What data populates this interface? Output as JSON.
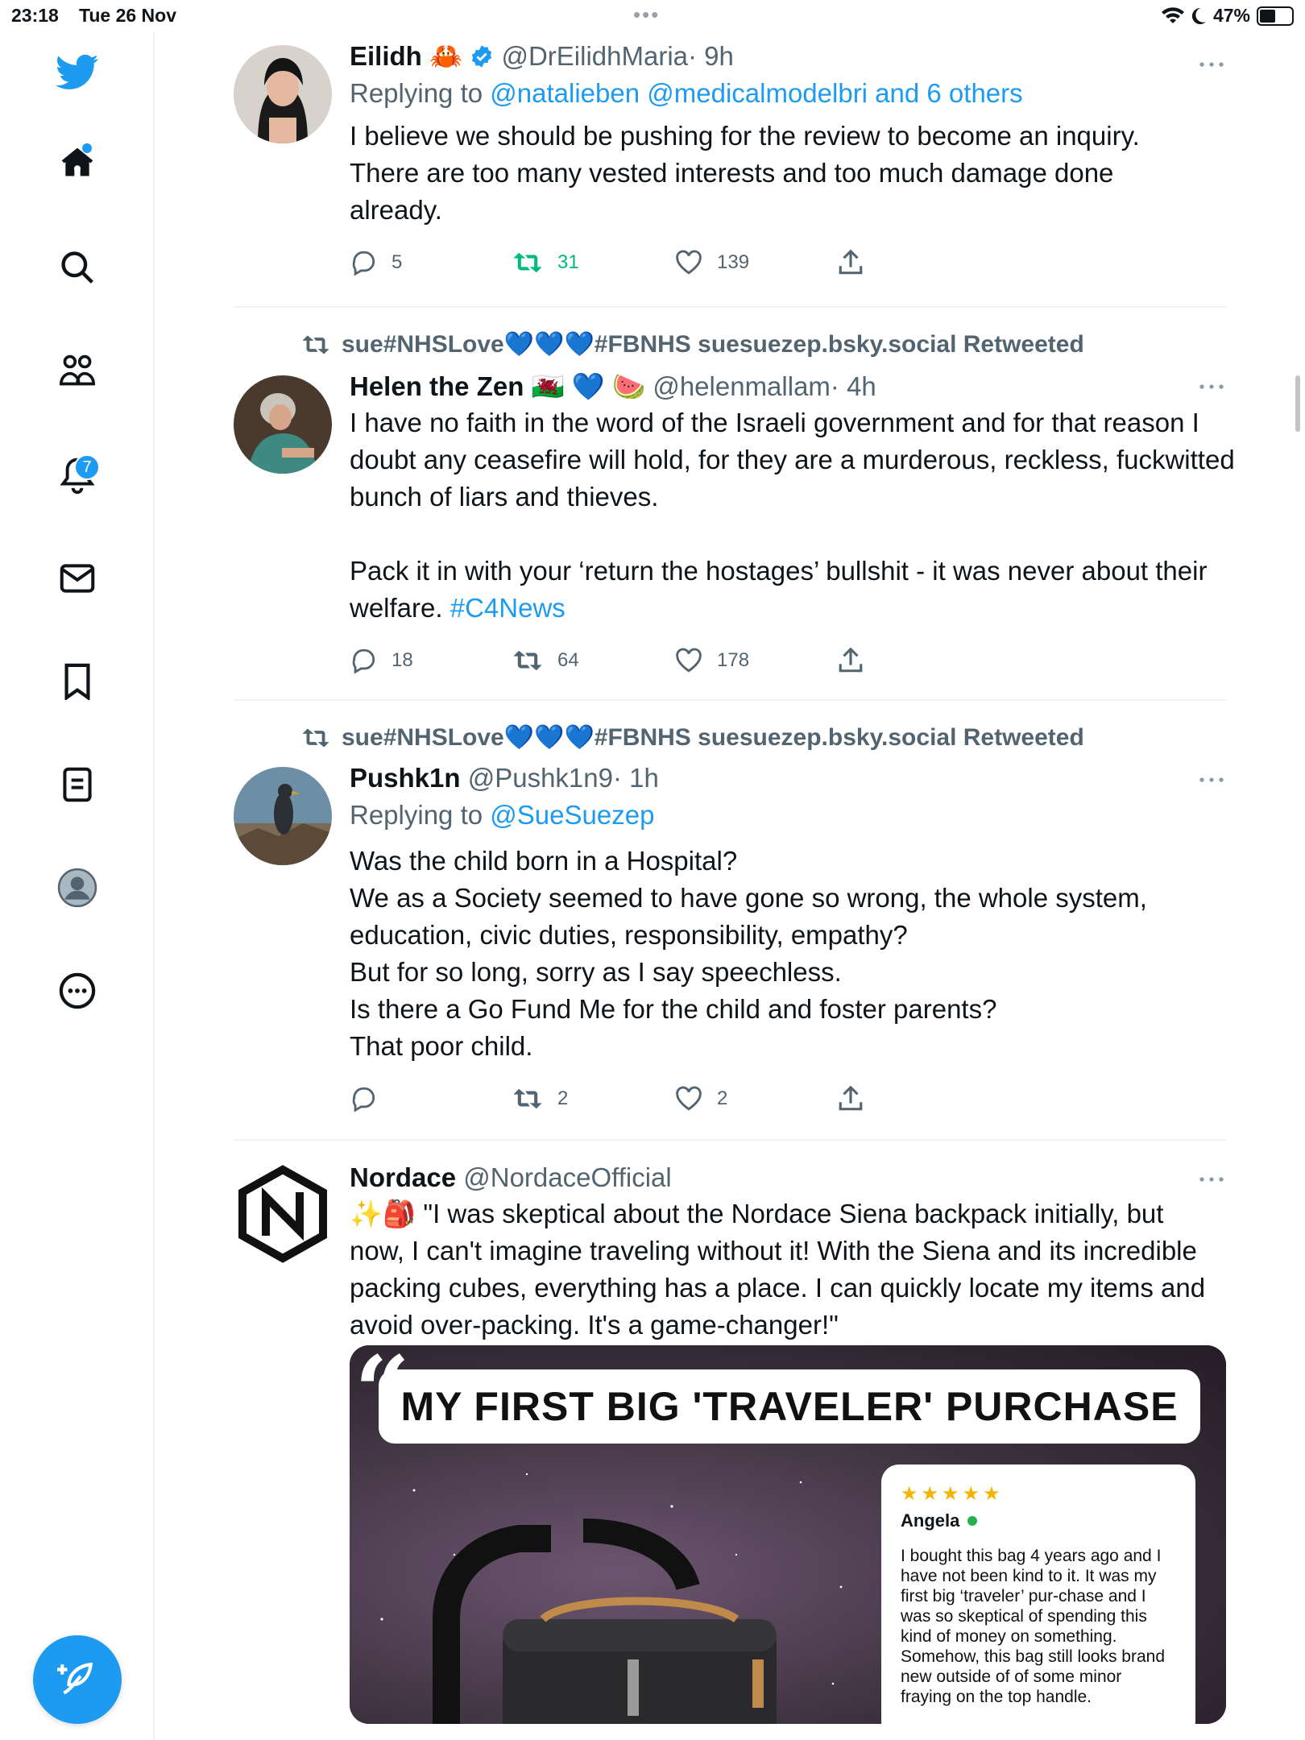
{
  "status_bar": {
    "time": "23:18",
    "date": "Tue 26 Nov",
    "battery": "47%"
  },
  "sidebar": {
    "items": [
      {
        "name": "twitter-logo"
      },
      {
        "name": "home"
      },
      {
        "name": "search"
      },
      {
        "name": "communities"
      },
      {
        "name": "notifications",
        "badge": "7"
      },
      {
        "name": "messages"
      },
      {
        "name": "bookmarks"
      },
      {
        "name": "lists"
      },
      {
        "name": "profile"
      },
      {
        "name": "more"
      }
    ],
    "compose_label": "Compose"
  },
  "tweets": [
    {
      "name": "Eilidh",
      "name_emoji": "🦀",
      "handle": "@DrEilidhMaria",
      "time": "· 9h",
      "replying_prefix": "Replying to",
      "replying_to": "@natalieben @medicalmodelbri and 6 others",
      "body": "I believe we should be pushing for the review to become an inquiry. There are too many vested interests and too much damage done already.",
      "replies": "5",
      "retweets": "31",
      "likes": "139"
    },
    {
      "retweeted_by": "sue#NHSLove💙💙💙#FBNHS suesuezep.bsky.social Retweeted",
      "name": "Helen the Zen",
      "name_emoji": "🏴󠁧󠁢󠁷󠁬󠁳󠁿 💙 🍉",
      "handle": "@helenmallam",
      "time": "· 4h",
      "body": "I have no faith in the word of the Israeli government and for that reason I doubt any ceasefire will hold, for they are a murderous, reckless, fuckwitted bunch of liars and thieves.\n\nPack it in with your ‘return the hostages’ bullshit - it was never about their welfare.",
      "hashtag": "#C4News",
      "replies": "18",
      "retweets": "64",
      "likes": "178"
    },
    {
      "retweeted_by": "sue#NHSLove💙💙💙#FBNHS suesuezep.bsky.social Retweeted",
      "name": "Pushk1n",
      "handle": "@Pushk1n9",
      "time": "· 1h",
      "replying_prefix": "Replying to",
      "replying_to": "@SueSuezep",
      "body": "Was the child born in a Hospital?\nWe as a Society seemed to have gone so wrong, the whole system, education, civic duties, responsibility, empathy?\nBut for so long, sorry as I say speechless.\nIs there a Go Fund Me for the child and foster parents?\nThat poor child.",
      "replies": "",
      "retweets": "2",
      "likes": "2"
    },
    {
      "name": "Nordace",
      "handle": "@NordaceOfficial",
      "body_emoji": "✨🎒",
      "body": " \"I was skeptical about the Nordace Siena backpack initially, but now, I can't imagine traveling without it! With the Siena and its incredible packing cubes, everything has a place. I can quickly locate my items and avoid over-packing. It's a game-changer!\"",
      "ad": {
        "quote_mark": "“",
        "title": "MY FIRST BIG 'TRAVELER' PURCHASE",
        "stars": "★★★★★",
        "reviewer": "Angela",
        "review": "I bought this bag 4 years ago and I have not been kind to it. It was my first big ‘traveler’ pur-chase and I was so skeptical of spending this kind of money on something. Somehow, this bag still looks brand new outside of of some minor fraying on the top handle."
      }
    }
  ]
}
